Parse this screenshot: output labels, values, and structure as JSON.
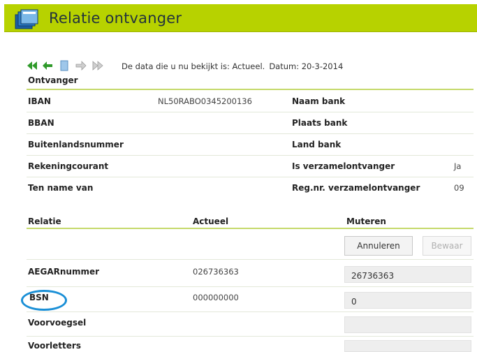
{
  "window": {
    "title": "Relatie ontvanger",
    "icon": "folder-stack-icon"
  },
  "nav": {
    "buttons": [
      "first-icon",
      "previous-icon",
      "document-icon",
      "next-icon",
      "last-icon"
    ],
    "status_prefix": "De data die u nu bekijkt is: Actueel.",
    "date_label": "Datum: 20-3-2014"
  },
  "ontvanger": {
    "section_label": "Ontvanger",
    "rows": [
      {
        "label": "IBAN",
        "value": "NL50RABO0345200136",
        "label2": "Naam bank",
        "value2": ""
      },
      {
        "label": "BBAN",
        "value": "",
        "label2": "Plaats bank",
        "value2": ""
      },
      {
        "label": "Buitenlandsnummer",
        "value": "",
        "label2": "Land bank",
        "value2": ""
      },
      {
        "label": "Rekeningcourant",
        "value": "",
        "label2": "Is verzamelontvanger",
        "value2": "Ja"
      },
      {
        "label": "Ten name van",
        "value": "",
        "label2": "Reg.nr. verzamelontvanger",
        "value2": "09"
      }
    ]
  },
  "relatie": {
    "headers": {
      "relatie": "Relatie",
      "actueel": "Actueel",
      "muteren": "Muteren"
    },
    "buttons": {
      "annuleren": "Annuleren",
      "bewaar": "Bewaar"
    },
    "rows": [
      {
        "label": "AEGARnummer",
        "actueel": "026736363",
        "muteren": "26736363"
      },
      {
        "label": "BSN",
        "actueel": "000000000",
        "muteren": "0"
      },
      {
        "label": "Voorvoegsel",
        "actueel": "",
        "muteren": ""
      },
      {
        "label": "Voorletters",
        "actueel": "",
        "muteren": ""
      }
    ]
  },
  "colors": {
    "accent_green": "#b7d200",
    "divider_green": "#c5d96a",
    "highlight_blue": "#1a8fd6"
  }
}
